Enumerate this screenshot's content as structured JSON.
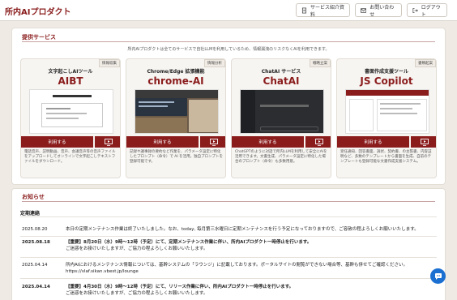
{
  "header": {
    "logo": "所内AIプロダクト",
    "buttons": [
      {
        "label": "サービス紹介資料",
        "icon": "document-icon"
      },
      {
        "label": "お問い合わせ",
        "icon": "mail-icon"
      },
      {
        "label": "ログアウト",
        "icon": "logout-icon"
      }
    ]
  },
  "services": {
    "title": "提供サービス",
    "lead": "所内AIプロダクトは全てのサービスで自社LLMを利用しているため、情報漏洩のリスクなくAIを利用できます。",
    "cards": [
      {
        "badge": "情報収集",
        "subtitle": "文字起こしAIツール",
        "name": "AIBT",
        "button": "利用する",
        "desc": "電話音声、説明動画、音声、会議音声等の音声ファイルをアップロードしてオンラインで文字起こしテキストファイルをダウンロード。"
      },
      {
        "badge": "情報分析",
        "subtitle": "Chrome/Edge 拡張機能",
        "name": "chrome-AI",
        "button": "利用する",
        "desc": "記録や議事録の要約など作業を、パラメータ設定に特化したプロンプト（命令）で AI を活用。独自プロンプトを登録可能です。"
      },
      {
        "badge": "戦略立案",
        "subtitle": "ChatAI サービス",
        "name": "ChatAI",
        "button": "利用する",
        "desc": "ChatGPTのように対話で所内LLMを利用して安全にAIを活用できます。文書生成、パラメータ設定に特化した場合のプロンプト（命令）も多数用意。"
      },
      {
        "badge": "書類起案",
        "subtitle": "書面作成支援ツール",
        "name": "JS Copilot",
        "button": "利用する",
        "desc": "受任通知、回答書面、訴状、契約書、の主張書、内容証明など、多数のテンプレートから書面を生成、自前のテンプレートも登録可能な文書作成支援システム。"
      }
    ]
  },
  "news": {
    "title": "お知らせ",
    "subtitle": "定期連絡",
    "items": [
      {
        "date": "2025.08.20",
        "bold": false,
        "line1": "本日の定期メンテナンス作業は終了いたしました。なお、today, 毎月第三水曜日に定期メンテナンスを行う予定になっておりますので、ご容赦の程よろしくお願いいたします。",
        "line2": ""
      },
      {
        "date": "2025.08.18",
        "bold": true,
        "line1": "【重要】8月20日（水）9時〜12時（予定）にて、定期メンテナンス作業に伴い、所内AIプロダクト一時停止を行います。",
        "line2": "ご迷惑をお掛けいたしますが、ご協力の程よろしくお願いいたします。"
      },
      {
        "date": "2025.04.14",
        "bold": false,
        "line1": "所内AIにおけるメンテナンス情報については、基幹システムの「ラウンジ」に記載しております。ポータルサイトの閲覧ができない場合等、基幹も併せてご確認ください。",
        "line2": "https://vlaf.sikan.vbest.jp/lounge"
      },
      {
        "date": "2025.04.14",
        "bold": true,
        "line1": "【重要】4月30日（水）9時〜12時（予定）にて、リリース作業に伴い、所内AIプロダクト一時停止を行います。",
        "line2": "ご迷惑をお掛けいたしますが、ご協力の程よろしくお願いいたします。"
      }
    ]
  }
}
